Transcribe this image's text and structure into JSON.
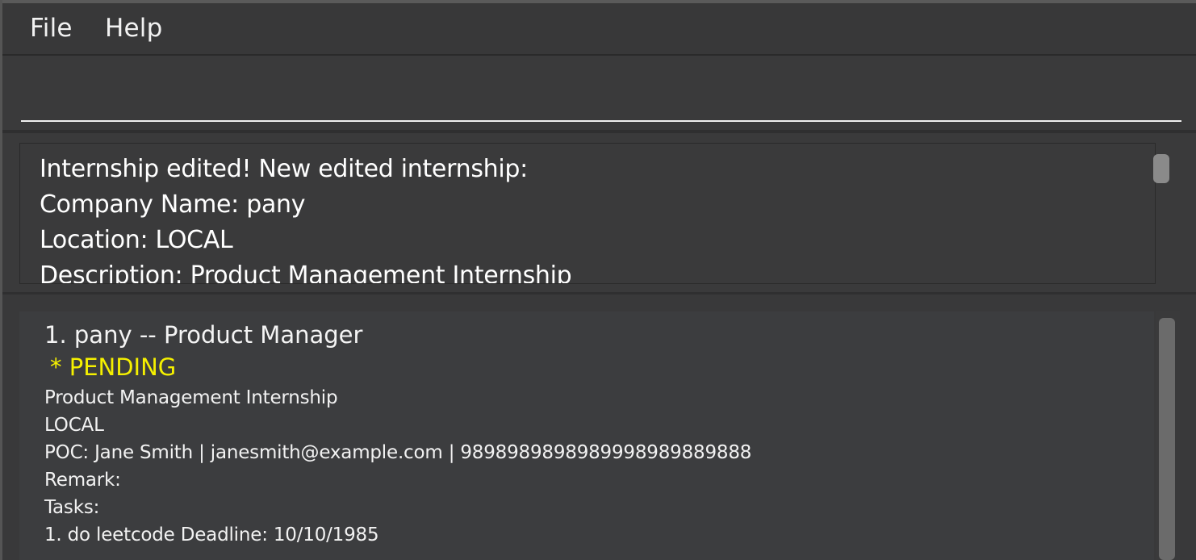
{
  "menubar": {
    "file_label": "File",
    "help_label": "Help"
  },
  "command": {
    "value": "",
    "placeholder": ""
  },
  "result": {
    "lines": [
      "Internship edited! New edited internship:",
      "Company Name: pany",
      "Location: LOCAL",
      "Description: Product Management Internship"
    ]
  },
  "internship_list": {
    "items": [
      {
        "index": "1.",
        "title": "1.  pany -- Product Manager",
        "status": "* PENDING",
        "description": "Product Management Internship",
        "location": "LOCAL",
        "poc": "POC: Jane Smith | janesmith@example.com | 9898989898989998989889888",
        "remark": "Remark:",
        "tasks_label": "Tasks:",
        "task_1": "1. do leetcode Deadline: 10/10/1985"
      }
    ]
  },
  "colors": {
    "background": "#3a3a3b",
    "status_pending": "#f5f000",
    "text": "#ffffff"
  }
}
